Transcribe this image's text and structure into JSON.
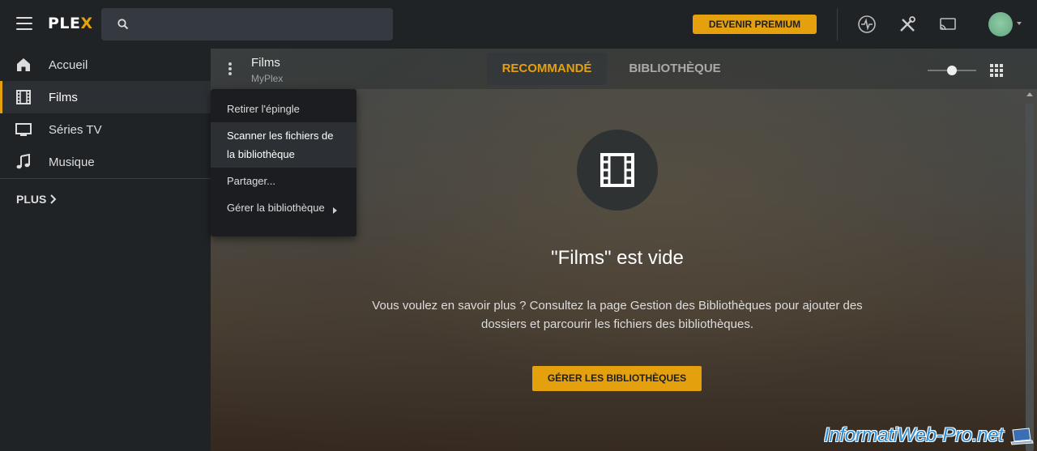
{
  "header": {
    "logo_main": "PLE",
    "logo_accent": "X",
    "premium_label": "DEVENIR PREMIUM"
  },
  "sidebar": {
    "items": [
      {
        "label": "Accueil",
        "icon": "home-icon"
      },
      {
        "label": "Films",
        "icon": "film-icon"
      },
      {
        "label": "Séries TV",
        "icon": "tv-icon"
      },
      {
        "label": "Musique",
        "icon": "music-icon"
      }
    ],
    "more_label": "PLUS"
  },
  "library": {
    "title": "Films",
    "subtitle": "MyPlex",
    "tabs": [
      "RECOMMANDÉ",
      "BIBLIOTHÈQUE"
    ]
  },
  "context_menu": {
    "items": [
      "Retirer l'épingle",
      "Scanner les fichiers de la bibliothèque",
      "Partager...",
      "Gérer la bibliothèque"
    ]
  },
  "empty_state": {
    "title": "\"Films\" est vide",
    "text": "Vous voulez en savoir plus ? Consultez la page Gestion des Bibliothèques pour ajouter des dossiers et parcourir les fichiers des bibliothèques.",
    "button_label": "GÉRER LES BIBLIOTHÈQUES"
  },
  "watermark": "InformatiWeb-Pro.net",
  "colors": {
    "accent": "#e5a00d",
    "sidebar_bg": "#1f2326"
  }
}
